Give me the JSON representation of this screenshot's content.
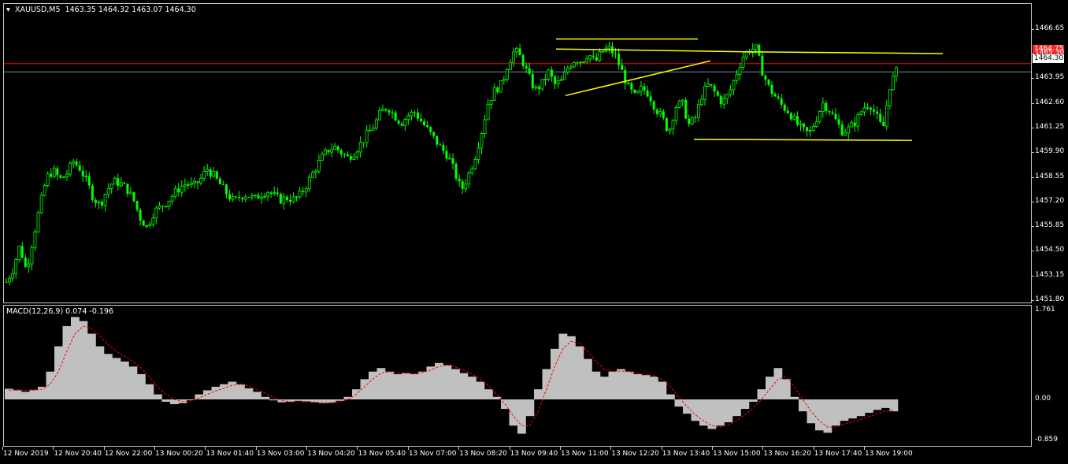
{
  "header": {
    "symbol_line": "XAUUSD,M5  1463.35 1464.32 1463.07 1464.30",
    "macd_line": "MACD(12,26,9) 0.074 -0.196"
  },
  "colors": {
    "background": "#000000",
    "bull_candle": "#00ff00",
    "bear_candle": "#00ff00",
    "trendline": "#ffff00",
    "ask_line": "#ff0000",
    "bid_line": "#778899",
    "macd_hist": "#c0c0c0",
    "macd_signal": "#ff0000"
  },
  "price_tags": {
    "ask": "1464.75",
    "bid": "1464.30"
  },
  "chart_data": [
    {
      "type": "candlestick",
      "name": "XAUUSD,M5",
      "ylim": [
        1451.8,
        1467.5
      ],
      "y_ticks": [
        "1466.65",
        "1465.30",
        "1463.95",
        "1462.60",
        "1461.25",
        "1459.90",
        "1458.55",
        "1457.20",
        "1455.85",
        "1454.50",
        "1453.15",
        "1451.80"
      ],
      "x_ticks": [
        "12 Nov 2019",
        "12 Nov 20:40",
        "12 Nov 22:00",
        "13 Nov 00:20",
        "13 Nov 01:40",
        "13 Nov 03:00",
        "13 Nov 04:20",
        "13 Nov 05:40",
        "13 Nov 07:00",
        "13 Nov 08:20",
        "13 Nov 09:40",
        "13 Nov 11:00",
        "13 Nov 12:20",
        "13 Nov 13:40",
        "13 Nov 15:00",
        "13 Nov 16:20",
        "13 Nov 17:40",
        "13 Nov 19:00"
      ],
      "close_path": [
        1452.8,
        1453.5,
        1454.8,
        1453.4,
        1455.2,
        1456.9,
        1458.5,
        1458.9,
        1458.4,
        1458.7,
        1459.4,
        1459.0,
        1458.3,
        1457.4,
        1457.0,
        1457.8,
        1458.3,
        1458.2,
        1457.9,
        1457.3,
        1456.3,
        1455.8,
        1456.6,
        1456.9,
        1457.2,
        1457.6,
        1458.0,
        1458.2,
        1458.0,
        1458.4,
        1459.0,
        1458.6,
        1458.1,
        1457.6,
        1457.2,
        1457.5,
        1457.6,
        1457.3,
        1457.6,
        1457.8,
        1457.5,
        1457.3,
        1457.4,
        1457.3,
        1457.6,
        1458.2,
        1458.9,
        1459.5,
        1460.0,
        1460.2,
        1459.9,
        1459.6,
        1459.9,
        1460.4,
        1460.9,
        1461.4,
        1462.1,
        1462.4,
        1461.9,
        1461.5,
        1461.9,
        1462.1,
        1461.6,
        1461.1,
        1460.6,
        1460.1,
        1459.7,
        1458.8,
        1457.8,
        1458.6,
        1459.6,
        1461.0,
        1462.6,
        1463.3,
        1463.6,
        1464.8,
        1465.5,
        1465.0,
        1464.1,
        1463.3,
        1463.6,
        1464.3,
        1463.6,
        1463.8,
        1464.6,
        1465.0,
        1464.9,
        1465.3,
        1464.8,
        1465.4,
        1465.6,
        1465.2,
        1464.3,
        1463.4,
        1462.9,
        1463.4,
        1463.1,
        1462.3,
        1461.8,
        1461.0,
        1462.4,
        1462.6,
        1461.4,
        1461.8,
        1463.1,
        1463.6,
        1463.1,
        1462.6,
        1463.1,
        1464.1,
        1465.1,
        1465.5,
        1465.6,
        1464.3,
        1463.4,
        1462.9,
        1462.4,
        1462.1,
        1461.5,
        1461.1,
        1460.9,
        1461.7,
        1462.6,
        1462.2,
        1461.6,
        1461.0,
        1461.2,
        1461.6,
        1462.3,
        1462.6,
        1461.9,
        1461.1,
        1463.5,
        1464.3
      ]
    },
    {
      "type": "histogram",
      "name": "MACD(12,26,9)",
      "ylim": [
        -0.859,
        1.761
      ],
      "y_ticks": [
        "1.761",
        "0.00",
        "-0.859"
      ],
      "values": [
        0.21,
        0.18,
        0.15,
        0.19,
        0.25,
        0.55,
        1.05,
        1.45,
        1.63,
        1.55,
        1.3,
        1.05,
        0.9,
        0.82,
        0.75,
        0.65,
        0.5,
        0.3,
        0.1,
        -0.05,
        -0.1,
        -0.08,
        0.0,
        0.1,
        0.18,
        0.25,
        0.3,
        0.35,
        0.3,
        0.22,
        0.15,
        0.05,
        -0.02,
        -0.06,
        -0.05,
        -0.03,
        -0.04,
        -0.06,
        -0.08,
        -0.07,
        -0.03,
        0.05,
        0.2,
        0.4,
        0.55,
        0.62,
        0.55,
        0.5,
        0.52,
        0.5,
        0.55,
        0.65,
        0.72,
        0.68,
        0.6,
        0.52,
        0.45,
        0.35,
        0.2,
        0.05,
        -0.2,
        -0.55,
        -0.72,
        -0.35,
        0.2,
        0.6,
        1.0,
        1.3,
        1.25,
        1.05,
        0.8,
        0.55,
        0.45,
        0.55,
        0.6,
        0.55,
        0.5,
        0.48,
        0.45,
        0.35,
        0.1,
        -0.15,
        -0.3,
        -0.45,
        -0.55,
        -0.62,
        -0.55,
        -0.48,
        -0.35,
        -0.2,
        -0.05,
        0.2,
        0.45,
        0.62,
        0.4,
        0.05,
        -0.25,
        -0.5,
        -0.65,
        -0.7,
        -0.55,
        -0.45,
        -0.4,
        -0.35,
        -0.28,
        -0.22,
        -0.18,
        -0.25
      ],
      "signal": [
        0.18,
        0.19,
        0.18,
        0.18,
        0.2,
        0.3,
        0.55,
        0.95,
        1.3,
        1.45,
        1.4,
        1.25,
        1.08,
        0.95,
        0.85,
        0.75,
        0.62,
        0.45,
        0.25,
        0.1,
        0.0,
        -0.05,
        -0.03,
        0.03,
        0.1,
        0.17,
        0.22,
        0.28,
        0.3,
        0.27,
        0.2,
        0.12,
        0.04,
        -0.02,
        -0.05,
        -0.05,
        -0.05,
        -0.06,
        -0.07,
        -0.07,
        -0.05,
        0.0,
        0.1,
        0.25,
        0.4,
        0.52,
        0.55,
        0.53,
        0.52,
        0.51,
        0.53,
        0.58,
        0.65,
        0.68,
        0.64,
        0.58,
        0.5,
        0.4,
        0.27,
        0.1,
        -0.1,
        -0.35,
        -0.55,
        -0.55,
        -0.25,
        0.2,
        0.65,
        1.0,
        1.15,
        1.1,
        0.95,
        0.75,
        0.6,
        0.55,
        0.56,
        0.55,
        0.52,
        0.5,
        0.47,
        0.4,
        0.25,
        0.05,
        -0.15,
        -0.32,
        -0.45,
        -0.55,
        -0.58,
        -0.53,
        -0.45,
        -0.32,
        -0.18,
        0.0,
        0.2,
        0.4,
        0.45,
        0.25,
        0.0,
        -0.25,
        -0.45,
        -0.58,
        -0.58,
        -0.52,
        -0.47,
        -0.42,
        -0.36,
        -0.3,
        -0.25,
        -0.22
      ]
    }
  ]
}
